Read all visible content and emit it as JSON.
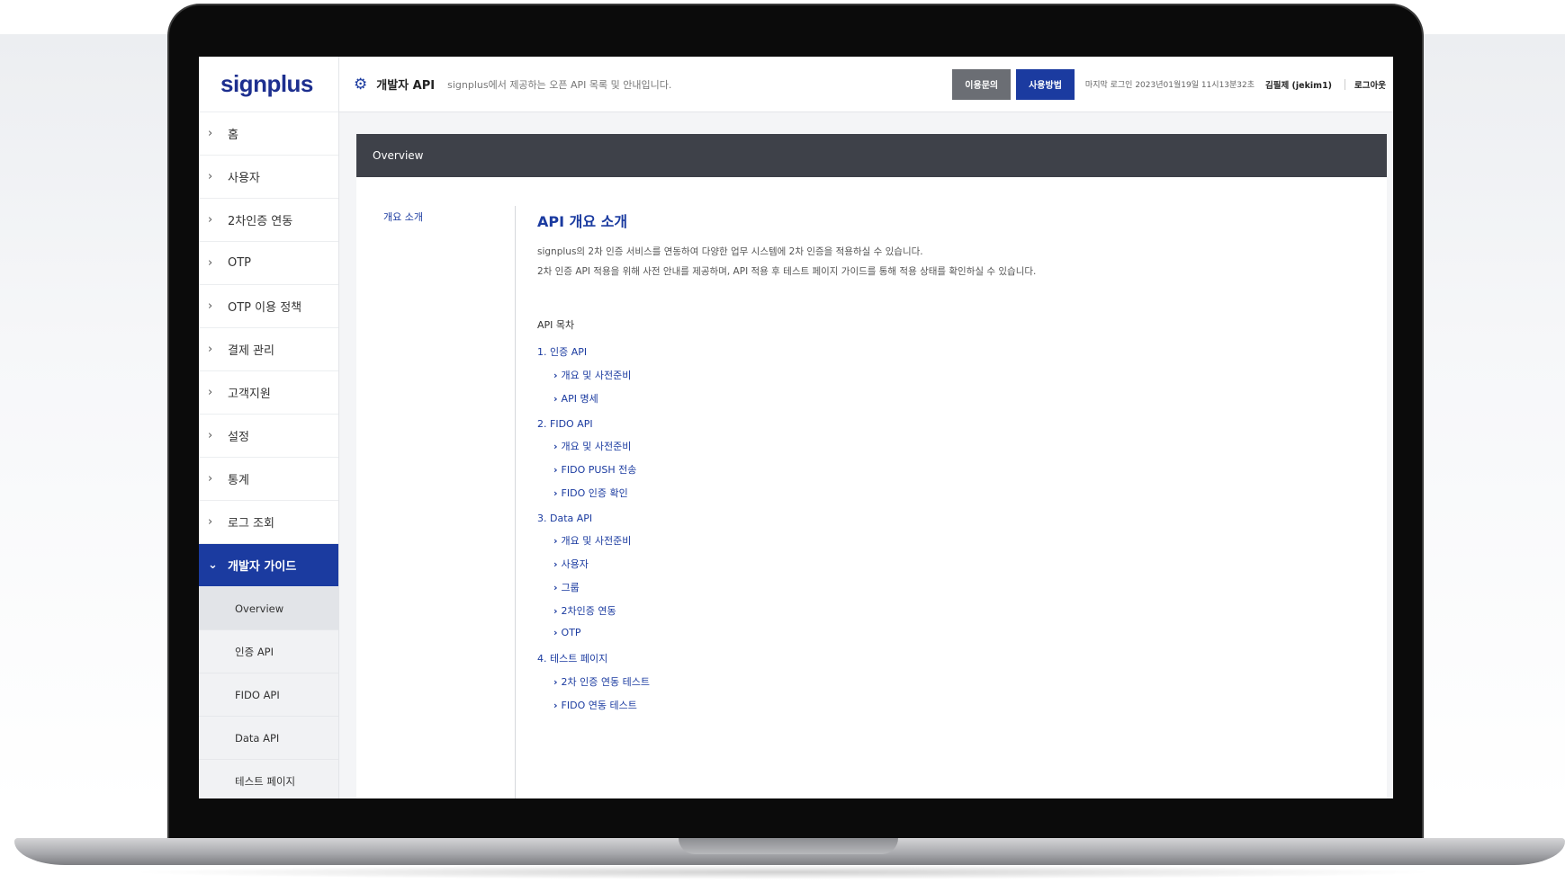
{
  "app": {
    "logo": "signplus",
    "header": {
      "title": "개발자 API",
      "description": "signplus에서 제공하는 오픈 API 목록 및 안내입니다.",
      "inquiry_button": "이용문의",
      "howto_button": "사용방법",
      "last_login": "마지막 로그인 2023년01월19일 11시13분32초",
      "user": "김필제 (jekim1)",
      "logout": "로그아웃"
    },
    "colors": {
      "brand": "#1b3ba0",
      "dark_bar": "#3e4149",
      "inquiry_button": "#6b6e74"
    }
  },
  "sidebar": {
    "items": [
      {
        "label": "홈",
        "icon": "chevron-right-icon"
      },
      {
        "label": "사용자",
        "icon": "chevron-right-icon"
      },
      {
        "label": "2차인증 연동",
        "icon": "chevron-right-icon"
      },
      {
        "label": "OTP",
        "icon": "chevron-right-icon"
      },
      {
        "label": "OTP 이용 정책",
        "icon": "chevron-right-icon"
      },
      {
        "label": "결제 관리",
        "icon": "chevron-right-icon"
      },
      {
        "label": "고객지원",
        "icon": "chevron-right-icon"
      },
      {
        "label": "설정",
        "icon": "chevron-right-icon"
      },
      {
        "label": "통계",
        "icon": "chevron-right-icon"
      },
      {
        "label": "로그 조회",
        "icon": "chevron-right-icon"
      },
      {
        "label": "개발자 가이드",
        "icon": "chevron-down-icon",
        "active": true
      }
    ],
    "sub_items": [
      {
        "label": "Overview",
        "current": true
      },
      {
        "label": "인증 API"
      },
      {
        "label": "FIDO API"
      },
      {
        "label": "Data API"
      },
      {
        "label": "테스트 페이지"
      }
    ]
  },
  "main": {
    "bar_title": "Overview",
    "doc_nav": "개요 소개",
    "title": "API 개요 소개",
    "paragraphs": [
      "signplus의 2차 인증 서비스를 연동하여 다양한 업무 시스템에 2차 인증을 적용하실 수 있습니다.",
      "2차 인증 API 적용을 위해 사전 안내를 제공하며, API 적용 후 테스트 페이지 가이드를 통해 적용 상태를 확인하실 수 있습니다."
    ],
    "toc_heading": "API 목차",
    "sections": [
      {
        "title": "1. 인증 API",
        "links": [
          "개요 및 사전준비",
          "API 명세"
        ]
      },
      {
        "title": "2. FIDO API",
        "links": [
          "개요 및 사전준비",
          "FIDO PUSH 전송",
          "FIDO 인증 확인"
        ]
      },
      {
        "title": "3. Data API",
        "links": [
          "개요 및 사전준비",
          "사용자",
          "그룹",
          "2차인증 연동",
          "OTP"
        ]
      },
      {
        "title": "4. 테스트 페이지",
        "links": [
          "2차 인증 연동 테스트",
          "FIDO 연동 테스트"
        ]
      }
    ]
  }
}
